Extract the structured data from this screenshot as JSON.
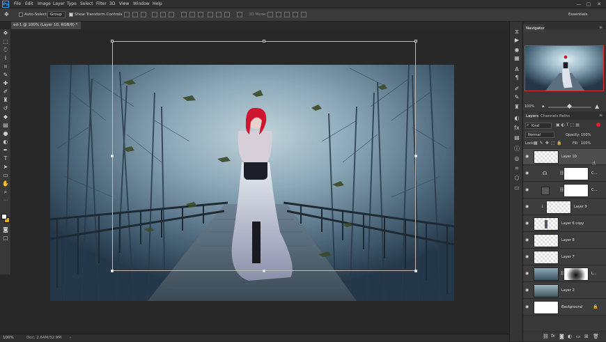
{
  "app": {
    "logo": "Ps"
  },
  "menu": [
    "File",
    "Edit",
    "Image",
    "Layer",
    "Type",
    "Select",
    "Filter",
    "3D",
    "View",
    "Window",
    "Help"
  ],
  "window_controls": [
    "—",
    "▢",
    "✕"
  ],
  "options": {
    "auto_select_label": "Auto-Select:",
    "auto_select_value": "Group",
    "show_transform_label": "Show Transform Controls",
    "mode_3d_label": "3D Mode:",
    "workspace": "Essentials"
  },
  "document": {
    "tab_title": "ed-1 @ 100% (Layer 10, RGB/8) *"
  },
  "status": {
    "zoom": "100%",
    "doc": "Doc: 2.64M/32.9M"
  },
  "navigator": {
    "tab_label": "Navigator",
    "zoom": "100%"
  },
  "layers_panel": {
    "tabs": [
      "Layers",
      "Channels",
      "Paths"
    ],
    "filter_kind": "Kind",
    "blend_mode": "Normal",
    "opacity_label": "Opacity:",
    "opacity_value": "100%",
    "lock_label": "Lock:",
    "fill_label": "Fill:",
    "fill_value": "100%",
    "layers": [
      {
        "name": "Layer 10"
      },
      {
        "name": "C..."
      },
      {
        "name": "C..."
      },
      {
        "name": "Layer 9"
      },
      {
        "name": "Layer 6 copy"
      },
      {
        "name": "Layer 8"
      },
      {
        "name": "Layer 7"
      },
      {
        "name": "L..."
      },
      {
        "name": "Layer 2"
      },
      {
        "name": "Background"
      }
    ],
    "footer_icons": [
      "link-icon",
      "fx-icon",
      "mask-icon",
      "adjustment-icon",
      "folder-icon",
      "new-layer-icon",
      "trash-icon"
    ]
  },
  "colors": {
    "foreground": "#ffffff",
    "background": "#e0b020",
    "accent": "#31a8ff",
    "nav_frame": "#e03030"
  }
}
